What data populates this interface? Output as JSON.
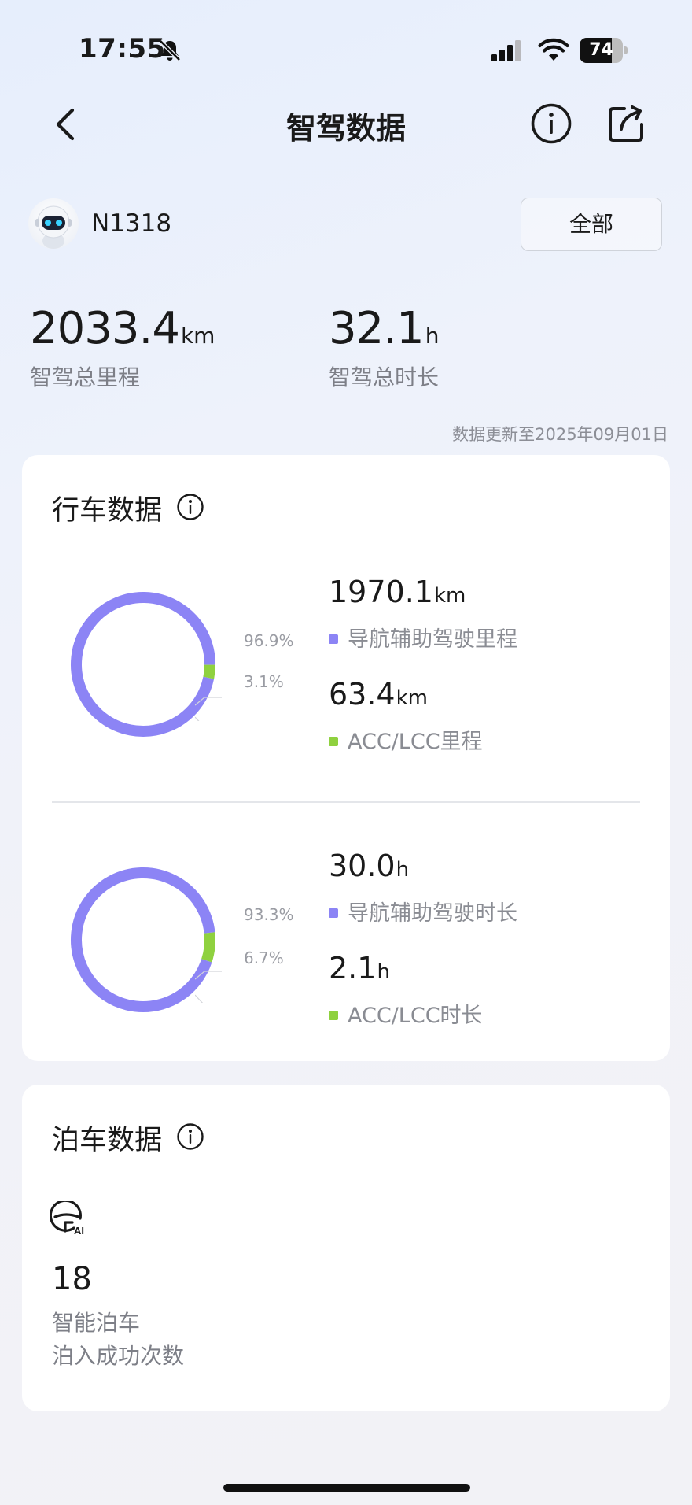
{
  "status_bar": {
    "time": "17:55",
    "battery": "74",
    "battery_level": 0.74
  },
  "nav": {
    "title": "智驾数据"
  },
  "vehicle": {
    "name": "N1318",
    "filter_label": "全部"
  },
  "summary": {
    "mileage": {
      "value": "2033.4",
      "unit": "km",
      "label": "智驾总里程"
    },
    "duration": {
      "value": "32.1",
      "unit": "h",
      "label": "智驾总时长"
    },
    "update_note": "数据更新至2025年09月01日"
  },
  "colors": {
    "nav_assist": "#8c84f5",
    "acc_lcc": "#8fd13f"
  },
  "driving": {
    "title": "行车数据",
    "mileage": {
      "nav_pct_label": "96.9%",
      "acc_pct_label": "3.1%",
      "nav_fraction": 0.969,
      "acc_fraction": 0.031,
      "nav_value": "1970.1",
      "nav_unit": "km",
      "nav_label": "导航辅助驾驶里程",
      "acc_value": "63.4",
      "acc_unit": "km",
      "acc_label": "ACC/LCC里程"
    },
    "duration": {
      "nav_pct_label": "93.3%",
      "acc_pct_label": "6.7%",
      "nav_fraction": 0.933,
      "acc_fraction": 0.067,
      "nav_value": "30.0",
      "nav_unit": "h",
      "nav_label": "导航辅助驾驶时长",
      "acc_value": "2.1",
      "acc_unit": "h",
      "acc_label": "ACC/LCC时长"
    }
  },
  "parking": {
    "title": "泊车数据",
    "icon": "steering-wheel-ai-icon",
    "count": "18",
    "label_line1": "智能泊车",
    "label_line2": "泊入成功次数"
  }
}
